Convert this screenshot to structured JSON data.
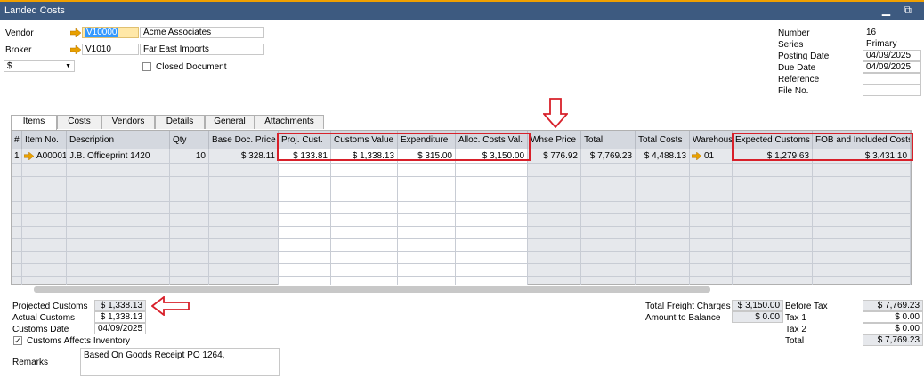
{
  "window": {
    "title": "Landed Costs",
    "controls": "▁ ⧉"
  },
  "header": {
    "vendor_label": "Vendor",
    "vendor_code": "V10000",
    "vendor_name": "Acme Associates",
    "broker_label": "Broker",
    "broker_code": "V1010",
    "broker_name": "Far East Imports",
    "currency": "$",
    "closed_doc_label": "Closed Document",
    "closed_doc_checked": false
  },
  "right_header": {
    "number_label": "Number",
    "number": "16",
    "series_label": "Series",
    "series": "Primary",
    "posting_label": "Posting Date",
    "posting": "04/09/2025",
    "due_label": "Due Date",
    "due": "04/09/2025",
    "reference_label": "Reference",
    "reference": "",
    "fileno_label": "File No.",
    "fileno": ""
  },
  "tabs": [
    "Items",
    "Costs",
    "Vendors",
    "Details",
    "General",
    "Attachments"
  ],
  "table": {
    "columns": [
      "#",
      "Item No.",
      "Description",
      "Qty",
      "Base Doc. Price",
      "Proj. Cust.",
      "Customs Value",
      "Expenditure",
      "Alloc. Costs Val.",
      "Whse Price",
      "Total",
      "Total Costs",
      "Warehouse",
      "Expected Customs",
      "FOB and Included Costs"
    ],
    "rows": [
      [
        "1",
        "A00001",
        "J.B. Officeprint 1420",
        "10",
        "$ 328.11",
        "$ 133.81",
        "$ 1,338.13",
        "$ 315.00",
        "$ 3,150.00",
        "$ 776.92",
        "$ 7,769.23",
        "$ 4,488.13",
        "01",
        "$ 1,279.63",
        "$ 3,431.10"
      ]
    ]
  },
  "footer": {
    "projected_label": "Projected Customs",
    "projected": "$ 1,338.13",
    "actual_label": "Actual Customs",
    "actual": "$ 1,338.13",
    "date_label": "Customs Date",
    "date": "04/09/2025",
    "affects_label": "Customs Affects Inventory",
    "affects_checked": true,
    "remarks_label": "Remarks",
    "remarks": "Based On Goods Receipt PO 1264,"
  },
  "totals": {
    "freight_label": "Total Freight Charges",
    "freight": "$ 3,150.00",
    "balance_label": "Amount to Balance",
    "balance": "$ 0.00",
    "before_tax_label": "Before Tax",
    "before_tax": "$ 7,769.23",
    "tax1_label": "Tax 1",
    "tax1": "$ 0.00",
    "tax2_label": "Tax 2",
    "tax2": "$ 0.00",
    "total_label": "Total",
    "total": "$ 7,769.23"
  },
  "colors": {
    "titlebar": "#3d5a80",
    "accent": "#f0a000",
    "annotation": "#d8202a",
    "link_arrow": "#e8a000"
  },
  "icons": [
    "link-arrow-icon",
    "minimize-icon",
    "restore-icon",
    "dropdown-arrow-icon",
    "checkbox-icon",
    "annotation-down-arrow",
    "annotation-left-arrow"
  ]
}
